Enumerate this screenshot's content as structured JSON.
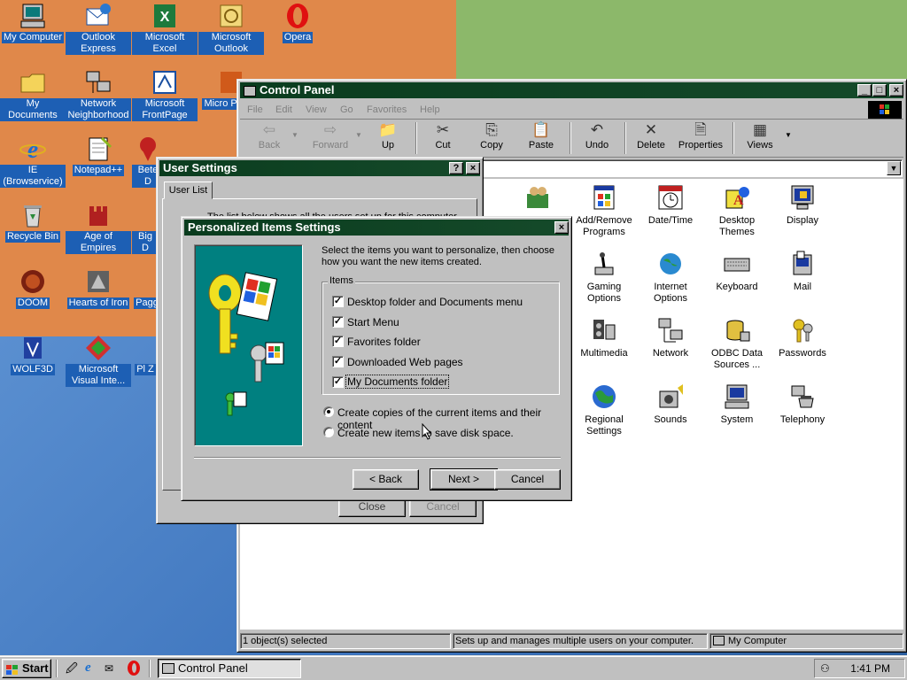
{
  "desktop": {
    "icons": [
      {
        "label": "My Computer"
      },
      {
        "label": "Outlook Express"
      },
      {
        "label": "Microsoft Excel"
      },
      {
        "label": "Microsoft Outlook"
      },
      {
        "label": "Opera"
      },
      {
        "label": "My Documents"
      },
      {
        "label": "Network Neighborhood"
      },
      {
        "label": "Microsoft FrontPage"
      },
      {
        "label": "Micro Power"
      },
      {
        "label": "IE (Browservice)"
      },
      {
        "label": "Notepad++"
      },
      {
        "label": "Bete D"
      },
      {
        "label": "Recycle Bin"
      },
      {
        "label": "Age of Empires"
      },
      {
        "label": "Big D"
      },
      {
        "label": "DOOM"
      },
      {
        "label": "Hearts of Iron"
      },
      {
        "label": "Pagg"
      },
      {
        "label": "WOLF3D"
      },
      {
        "label": "Microsoft Visual Inte..."
      },
      {
        "label": "Pl Z"
      }
    ]
  },
  "control_panel": {
    "title": "Control Panel",
    "menu": [
      "File",
      "Edit",
      "View",
      "Go",
      "Favorites",
      "Help"
    ],
    "toolbar": {
      "back": "Back",
      "forward": "Forward",
      "up": "Up",
      "cut": "Cut",
      "copy": "Copy",
      "paste": "Paste",
      "undo": "Undo",
      "delete": "Delete",
      "properties": "Properties",
      "views": "Views"
    },
    "items": [
      {
        "label": "Add/Remove Programs",
        "icon": "add-remove-icon"
      },
      {
        "label": "Date/Time",
        "icon": "clock-icon"
      },
      {
        "label": "Desktop Themes",
        "icon": "themes-icon"
      },
      {
        "label": "Display",
        "icon": "display-icon"
      },
      {
        "label": "Gaming Options",
        "icon": "joystick-icon"
      },
      {
        "label": "Internet Options",
        "icon": "globe-icon"
      },
      {
        "label": "Keyboard",
        "icon": "keyboard-icon"
      },
      {
        "label": "Mail",
        "icon": "mail-icon"
      },
      {
        "label": "Multimedia",
        "icon": "multimedia-icon"
      },
      {
        "label": "Network",
        "icon": "network-icon"
      },
      {
        "label": "ODBC Data Sources ...",
        "icon": "database-icon"
      },
      {
        "label": "Passwords",
        "icon": "keys-icon"
      },
      {
        "label": "Regional Settings",
        "icon": "globe-icon"
      },
      {
        "label": "Sounds",
        "icon": "speaker-icon"
      },
      {
        "label": "System",
        "icon": "computer-icon"
      },
      {
        "label": "Telephony",
        "icon": "phone-icon"
      }
    ],
    "status": {
      "selected": "1 object(s) selected",
      "description": "Sets up and manages multiple users on your computer.",
      "zone": "My Computer"
    }
  },
  "user_settings": {
    "title": "User Settings",
    "tab": "User List",
    "body_text": "The list below shows all the users set up for this computer.",
    "close": "Close",
    "cancel": "Cancel"
  },
  "personalized": {
    "title": "Personalized Items Settings",
    "instructions": "Select the items you want to personalize, then choose how you want the new items created.",
    "group_label": "Items",
    "items": [
      {
        "label": "Desktop folder and Documents menu",
        "checked": true
      },
      {
        "label": "Start Menu",
        "checked": true
      },
      {
        "label": "Favorites folder",
        "checked": true
      },
      {
        "label": "Downloaded Web pages",
        "checked": true
      },
      {
        "label": "My Documents folder",
        "checked": true
      }
    ],
    "radio_copy": "Create copies of the current items and their content",
    "radio_new": "Create new items to save disk space.",
    "back": "< Back",
    "next": "Next >",
    "cancel": "Cancel"
  },
  "taskbar": {
    "start": "Start",
    "task": "Control Panel",
    "clock": "1:41 PM"
  },
  "colors": {
    "titlebar_active": "#0a3c1e",
    "face": "#c0c0c0",
    "teal": "#008080",
    "desktop_orange": "#e0884a",
    "desktop_green": "#8cb86a",
    "desktop_blue": "#3d74bd"
  }
}
